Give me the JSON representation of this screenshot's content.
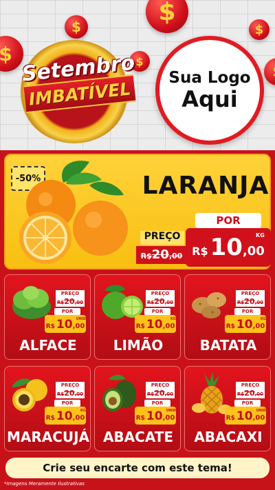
{
  "header": {
    "campaign_line1": "Setembro",
    "campaign_line2": "IMBATÍVEL",
    "logo_line1": "Sua Logo",
    "logo_line2": "Aqui",
    "coin_symbol": "$"
  },
  "featured": {
    "discount": "-50%",
    "name": "LARANJA",
    "preco_label": "PREÇO",
    "old_currency": "R$",
    "old_int": "20",
    "old_dec": ",00",
    "por_label": "POR",
    "currency": "R$",
    "price_int": "10",
    "price_dec": ",00",
    "unit": "KG"
  },
  "products": [
    {
      "name": "ALFACE",
      "preco_label": "PREÇO",
      "old_currency": "R$",
      "old_int": "20",
      "old_dec": ",00",
      "por_label": "POR",
      "currency": "R$",
      "price_int": "10",
      "price_dec": ",00",
      "unit": "UNID"
    },
    {
      "name": "LIMÃO",
      "preco_label": "PREÇO",
      "old_currency": "R$",
      "old_int": "20",
      "old_dec": ",00",
      "por_label": "POR",
      "currency": "R$",
      "price_int": "10",
      "price_dec": ",00",
      "unit": "KG"
    },
    {
      "name": "BATATA",
      "preco_label": "PREÇO",
      "old_currency": "R$",
      "old_int": "20",
      "old_dec": ",00",
      "por_label": "POR",
      "currency": "R$",
      "price_int": "10",
      "price_dec": ",00",
      "unit": "KG"
    },
    {
      "name": "MARACUJÁ",
      "preco_label": "PREÇO",
      "old_currency": "R$",
      "old_int": "20",
      "old_dec": ",00",
      "por_label": "POR",
      "currency": "R$",
      "price_int": "10",
      "price_dec": ",00",
      "unit": "KG"
    },
    {
      "name": "ABACATE",
      "preco_label": "PREÇO",
      "old_currency": "R$",
      "old_int": "20",
      "old_dec": ",00",
      "por_label": "POR",
      "currency": "R$",
      "price_int": "10",
      "price_dec": ",00",
      "unit": "UNID"
    },
    {
      "name": "ABACAXI",
      "preco_label": "PREÇO",
      "old_currency": "R$",
      "old_int": "20",
      "old_dec": ",00",
      "por_label": "POR",
      "currency": "R$",
      "price_int": "10",
      "price_dec": ",00",
      "unit": "UNID"
    }
  ],
  "footer": {
    "cta": "Crie seu encarte com este tema!",
    "note": "*Imagens Meramente Ilustrativas"
  },
  "colors": {
    "background_red": "#c8121a",
    "featured_yellow": "#ffd23a",
    "price_yellow": "#ffc21a",
    "text_dark": "#111111"
  },
  "icons": [
    "dollar-coin-icon",
    "orange-icon",
    "lettuce-icon",
    "lime-icon",
    "potato-icon",
    "passion-fruit-icon",
    "avocado-icon",
    "pineapple-icon"
  ]
}
